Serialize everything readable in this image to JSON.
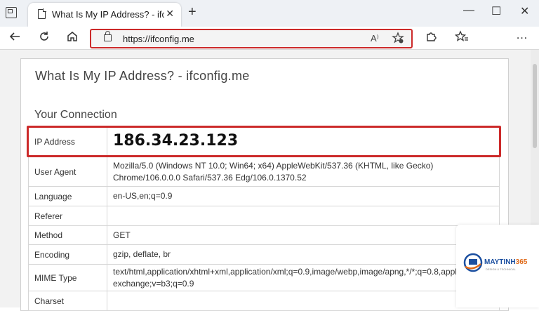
{
  "browser": {
    "tab": {
      "title": "What Is My IP Address? - ifconfig",
      "close": "✕"
    },
    "new_tab": "+",
    "window_controls": {
      "minimize": "—",
      "maximize": "☐",
      "close": "✕"
    },
    "address_bar": {
      "url": "https://ifconfig.me",
      "read_aloud": "A⁾"
    },
    "toolbar_icons": [
      "back-icon",
      "refresh-icon",
      "home-icon",
      "extensions-icon",
      "favorites-icon",
      "more-icon"
    ]
  },
  "page": {
    "title": "What Is My IP Address? - ifconfig.me",
    "section": "Your Connection",
    "rows": [
      {
        "key": "IP Address",
        "value": "186.34.23.123"
      },
      {
        "key": "User Agent",
        "value": "Mozilla/5.0 (Windows NT 10.0; Win64; x64) AppleWebKit/537.36 (KHTML, like Gecko) Chrome/106.0.0.0 Safari/537.36 Edg/106.0.1370.52"
      },
      {
        "key": "Language",
        "value": "en-US,en;q=0.9"
      },
      {
        "key": "Referer",
        "value": ""
      },
      {
        "key": "Method",
        "value": "GET"
      },
      {
        "key": "Encoding",
        "value": "gzip, deflate, br"
      },
      {
        "key": "MIME Type",
        "value": "text/html,application/xhtml+xml,application/xml;q=0.9,image/webp,image/apng,*/*;q=0.8,application/signed-exchange;v=b3;q=0.9"
      },
      {
        "key": "Charset",
        "value": ""
      }
    ]
  },
  "watermark": {
    "brand_a": "MAYTINH",
    "brand_b": "365",
    "tagline": "DESIGN & TECHNICAL"
  },
  "colors": {
    "highlight": "#cc2a2a",
    "brand_blue": "#1b4fa0",
    "brand_orange": "#e06b1a"
  }
}
